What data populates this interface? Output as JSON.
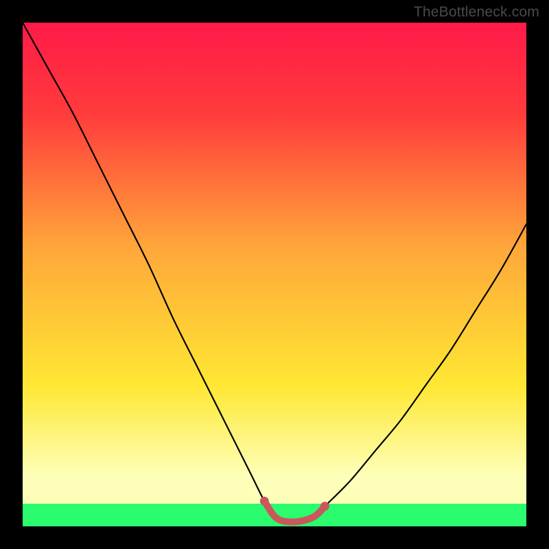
{
  "watermark": "TheBottleneck.com",
  "colors": {
    "top": "#ff1a49",
    "upper": "#ff3b3b",
    "orange": "#ffa83a",
    "yellow": "#ffe733",
    "pale": "#fdffb8",
    "green": "#2bfc6e",
    "curve": "#000000",
    "valley": "#c9585d"
  },
  "chart_data": {
    "type": "line",
    "title": "",
    "xlabel": "",
    "ylabel": "",
    "xlim": [
      0,
      100
    ],
    "ylim": [
      0,
      100
    ],
    "series": [
      {
        "name": "bottleneck-curve",
        "x": [
          0,
          5,
          10,
          15,
          20,
          25,
          30,
          35,
          40,
          45,
          48,
          50,
          52,
          55,
          58,
          60,
          65,
          70,
          75,
          80,
          85,
          90,
          95,
          100
        ],
        "y": [
          100,
          91,
          82,
          72,
          62,
          52,
          41,
          31,
          21,
          11,
          5,
          2,
          1,
          1,
          2,
          4,
          9,
          15,
          21,
          28,
          35,
          43,
          51,
          60
        ]
      },
      {
        "name": "valley-highlight",
        "x": [
          48,
          50,
          52,
          55,
          58,
          60
        ],
        "y": [
          5,
          2,
          1,
          1,
          2,
          4
        ]
      }
    ],
    "annotations": []
  }
}
